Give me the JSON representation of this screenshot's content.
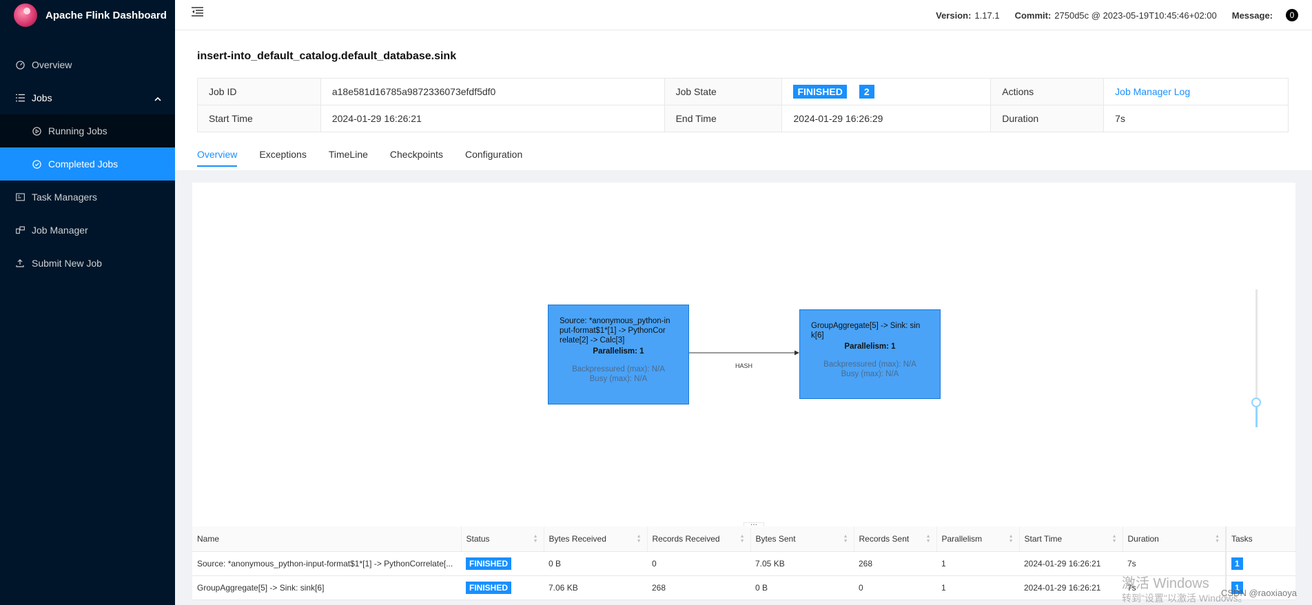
{
  "app": {
    "title": "Apache Flink Dashboard"
  },
  "sidebar": {
    "items": [
      {
        "label": "Overview",
        "icon": "dashboard-icon"
      },
      {
        "label": "Jobs",
        "icon": "list-icon"
      },
      {
        "label": "Running Jobs",
        "icon": "play-circle-icon"
      },
      {
        "label": "Completed Jobs",
        "icon": "check-circle-icon"
      },
      {
        "label": "Task Managers",
        "icon": "schedule-icon"
      },
      {
        "label": "Job Manager",
        "icon": "build-icon"
      },
      {
        "label": "Submit New Job",
        "icon": "upload-icon"
      }
    ]
  },
  "header": {
    "version_label": "Version:",
    "version": "1.17.1",
    "commit_label": "Commit:",
    "commit": "2750d5c @ 2023-05-19T10:45:46+02:00",
    "message_label": "Message:",
    "message_count": "0"
  },
  "job": {
    "title": "insert-into_default_catalog.default_database.sink",
    "id_label": "Job ID",
    "id": "a18e581d16785a9872336073efdf5df0",
    "state_label": "Job State",
    "state": "FINISHED",
    "state_count": "2",
    "actions_label": "Actions",
    "actions_link": "Job Manager Log",
    "start_label": "Start Time",
    "start": "2024-01-29 16:26:21",
    "end_label": "End Time",
    "end": "2024-01-29 16:26:29",
    "duration_label": "Duration",
    "duration": "7s"
  },
  "tabs": [
    "Overview",
    "Exceptions",
    "TimeLine",
    "Checkpoints",
    "Configuration"
  ],
  "graph": {
    "nodes": [
      {
        "name": "Source: *anonymous_python-input-format$1*[1] -> PythonCorrelate[2] -> Calc[3]",
        "name_lines": [
          "Source: *anonymous_python-in",
          "put-format$1*[1] -> PythonCor",
          "relate[2] -> Calc[3]"
        ],
        "parallelism": "Parallelism: 1",
        "backpressured": "Backpressured (max): N/A",
        "busy": "Busy (max): N/A"
      },
      {
        "name": "GroupAggregate[5] -> Sink: sink[6]",
        "name_lines": [
          "GroupAggregate[5] -> Sink: sin",
          "k[6]"
        ],
        "parallelism": "Parallelism: 1",
        "backpressured": "Backpressured (max): N/A",
        "busy": "Busy (max): N/A"
      }
    ],
    "edge_label": "HASH"
  },
  "vertex_table": {
    "columns": [
      "Name",
      "Status",
      "Bytes Received",
      "Records Received",
      "Bytes Sent",
      "Records Sent",
      "Parallelism",
      "Start Time",
      "Duration",
      "Tasks"
    ],
    "rows": [
      {
        "name": "Source: *anonymous_python-input-format$1*[1] -> PythonCorrelate[...",
        "status": "FINISHED",
        "bytes_received": "0 B",
        "records_received": "0",
        "bytes_sent": "7.05 KB",
        "records_sent": "268",
        "parallelism": "1",
        "start_time": "2024-01-29 16:26:21",
        "duration": "7s",
        "tasks": "1"
      },
      {
        "name": "GroupAggregate[5] -> Sink: sink[6]",
        "status": "FINISHED",
        "bytes_received": "7.06 KB",
        "records_received": "268",
        "bytes_sent": "0 B",
        "records_sent": "0",
        "parallelism": "1",
        "start_time": "2024-01-29 16:26:21",
        "duration": "7s",
        "tasks": "1"
      }
    ]
  },
  "overlay": {
    "windows_watermark": "激活 Windows",
    "windows_watermark_sub": "转到\"设置\"以激活 Windows。",
    "csdn": "CSDN @raoxiaoya"
  },
  "colors": {
    "sidebar_bg": "#001529",
    "submenu_bg": "#000c17",
    "accent": "#1890ff",
    "node_fill": "#4aa3f7"
  }
}
